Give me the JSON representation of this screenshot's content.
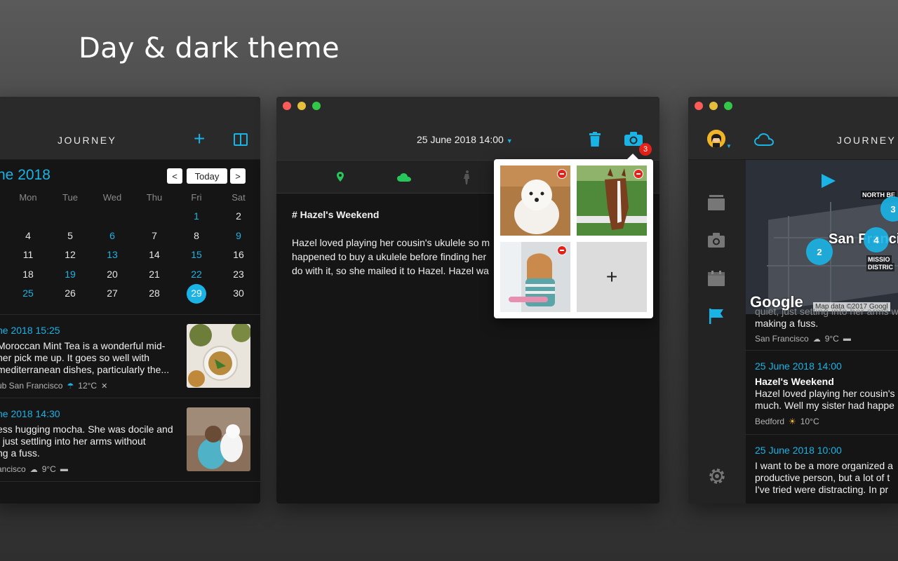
{
  "hero": {
    "title": "Day & dark theme"
  },
  "colors": {
    "accent": "#1ab3e6",
    "bg": "#151515",
    "toolbar": "#2a2a2a",
    "badge": "#e4221a",
    "location_green": "#27c65a"
  },
  "left": {
    "app_title": "JOURNEY",
    "month": "ne 2018",
    "today_label": "Today",
    "prev_label": "<",
    "next_label": ">",
    "weekdays": [
      "Mon",
      "Tue",
      "Wed",
      "Thu",
      "Fri",
      "Sat"
    ],
    "weeks": [
      [
        "",
        "",
        "",
        "",
        "1",
        "2"
      ],
      [
        "4",
        "5",
        "6",
        "7",
        "8",
        "9"
      ],
      [
        "11",
        "12",
        "13",
        "14",
        "15",
        "16"
      ],
      [
        "18",
        "19",
        "20",
        "21",
        "22",
        "23"
      ],
      [
        "25",
        "26",
        "27",
        "28",
        "29",
        "30"
      ]
    ],
    "highlighted_days": [
      "1",
      "6",
      "9",
      "13",
      "15",
      "19",
      "22",
      "25"
    ],
    "selected_day": "29",
    "entries": [
      {
        "date": "ne 2018 15:25",
        "lines": [
          "Moroccan Mint Tea is a wonderful mid-",
          "her pick me up. It goes so well with",
          " mediterranean dishes, particularly the..."
        ],
        "location": "ub San Francisco",
        "temp": "12°C"
      },
      {
        "date": "ne 2018 14:30",
        "lines": [
          "ess hugging mocha. She was docile and",
          ", just settling into her arms without",
          "ng a fuss."
        ],
        "location": "ancisco",
        "temp": "9°C"
      }
    ]
  },
  "middle": {
    "datetime": "25 June 2018 14:00",
    "photo_count": "3",
    "heading": "# Hazel's Weekend",
    "body_lines": [
      "Hazel loved playing her cousin's ukulele so m",
      "happened to buy a ukulele before finding her",
      "do with it, so she mailed it to Hazel. Hazel wa"
    ],
    "add_photo_label": "+"
  },
  "right": {
    "app_title": "JOURNEY",
    "map": {
      "city_label": "San Franci",
      "north_label": "NORTH BE",
      "mission_label_1": "MISSIO",
      "mission_label_2": "DISTRIC",
      "google_label": "Google",
      "map_data_label": "Map data ©2017 Googl",
      "clusters": [
        "2",
        "4",
        "3"
      ]
    },
    "entries": [
      {
        "lines": [
          "quiet, just setting into her arms without",
          "making a fuss."
        ],
        "location": "San Francisco",
        "temp": "9°C"
      },
      {
        "date": "25 June 2018 14:00",
        "title": "Hazel's Weekend",
        "lines": [
          "Hazel loved playing her cousin's",
          "much. Well my sister had happe"
        ],
        "location": "Bedford",
        "temp": "10°C"
      },
      {
        "date": "25 June 2018 10:00",
        "lines": [
          "I want to be a more organized a",
          "productive person, but a lot of t",
          "I've tried were distracting. In pr"
        ]
      }
    ]
  }
}
